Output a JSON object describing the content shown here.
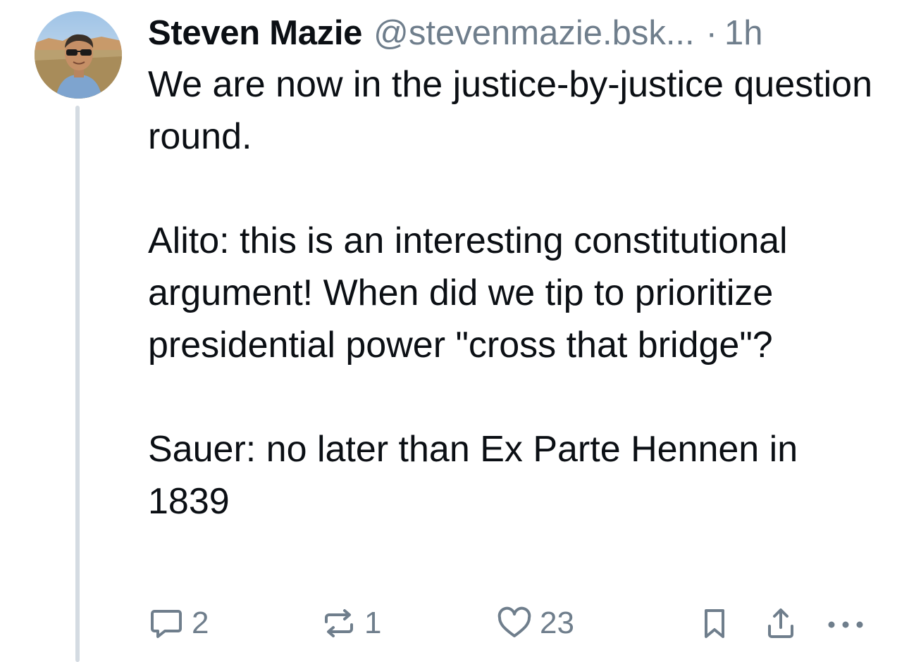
{
  "post": {
    "author": {
      "display_name": "Steven Mazie",
      "handle": "@stevenmazie.bsk...",
      "avatar_icon": "profile-photo-icon"
    },
    "separator": "·",
    "timestamp": "1h",
    "text": {
      "p1": "We are now in the justice-by-justice question round.",
      "p2": "Alito: this is an interesting constitutional argument! When did we tip to prioritize presidential power \"cross that bridge\"?",
      "p3": "Sauer: no later than Ex Parte Hennen in 1839"
    },
    "actions": {
      "reply_count": "2",
      "repost_count": "1",
      "like_count": "23",
      "reply_icon": "speech-bubble-icon",
      "repost_icon": "repost-arrows-icon",
      "like_icon": "heart-icon",
      "bookmark_icon": "bookmark-icon",
      "share_icon": "share-icon",
      "more_icon": "ellipsis-icon"
    }
  },
  "colors": {
    "text": "#0b0f14",
    "muted": "#6f7e8c",
    "thread_line": "#d4dbe2",
    "background": "#ffffff"
  }
}
